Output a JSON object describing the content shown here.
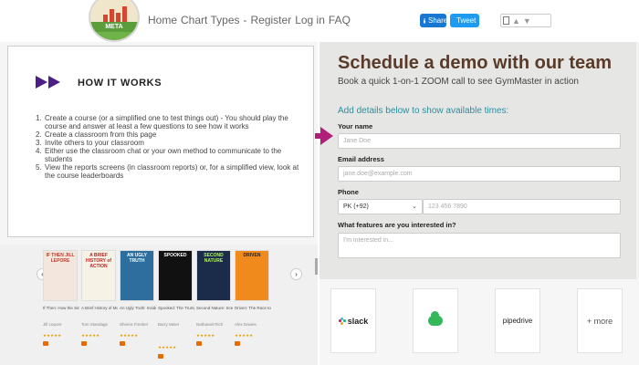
{
  "brand": {
    "logo_text": "META"
  },
  "topnav": {
    "items": [
      "Home",
      "Chart Types",
      "-",
      "Register",
      "Log in",
      "FAQ"
    ]
  },
  "share": {
    "facebook": "Share",
    "twitter": "Tweet"
  },
  "how_it_works": {
    "title": "HOW IT WORKS",
    "steps": [
      {
        "n": "1.",
        "text": "Create a course (or a simplified one to test things out) - You should play the course and answer at least a few questions to see how it works"
      },
      {
        "n": "2.",
        "text": "Create a classroom from this page"
      },
      {
        "n": "3.",
        "text": "Invite others to your classroom"
      },
      {
        "n": "4.",
        "text": "Either use the classroom chat or your own method to communicate to the students"
      },
      {
        "n": "5.",
        "text": "View the reports screens (in classroom reports) or, for a simplified view, look at the course leaderboards"
      }
    ]
  },
  "books": [
    {
      "cover": "IF THEN JILL LEPORE",
      "title": "If Then: How the Simulmatics...",
      "author": "Jill Lepore"
    },
    {
      "cover": "A BRIEF HISTORY of ACTION",
      "title": "A Brief History of Motion: From the...",
      "author": "Tom Standage"
    },
    {
      "cover": "AN UGLY TRUTH",
      "title": "An Ugly Truth: Inside Facebook's Battle for...",
      "author": "Sheera Frenkel"
    },
    {
      "cover": "SPOOKED",
      "title": "Spooked: The Trump Dossier, Black Cube, ...",
      "author": "Barry Meier"
    },
    {
      "cover": "SECOND NATURE",
      "title": "Second Nature: Scenes from the Remade...",
      "author": "Nathaniel Rich"
    },
    {
      "cover": "DRIVEN",
      "title": "Driven: The Race to Create the Autonomo...",
      "author": "Alex Davies"
    }
  ],
  "demo": {
    "heading": "Schedule a demo with our team",
    "subheading": "Book a quick 1-on-1 ZOOM call to see GymMaster in action",
    "prompt": "Add details below to show available times:",
    "name_label": "Your name",
    "name_placeholder": "Jane Doe",
    "email_label": "Email address",
    "email_placeholder": "jane.doe@example.com",
    "phone_label": "Phone",
    "phone_country": "PK (+92)",
    "phone_placeholder": "123 456 7890",
    "features_label": "What features are you interested in?",
    "features_placeholder": "I'm interested in..."
  },
  "integrations": [
    "slack",
    "",
    "pipedrive",
    "+ more"
  ],
  "colors": {
    "heading": "#5a3b2a",
    "accent": "#2b8fa0",
    "pointer": "#b0207a"
  }
}
